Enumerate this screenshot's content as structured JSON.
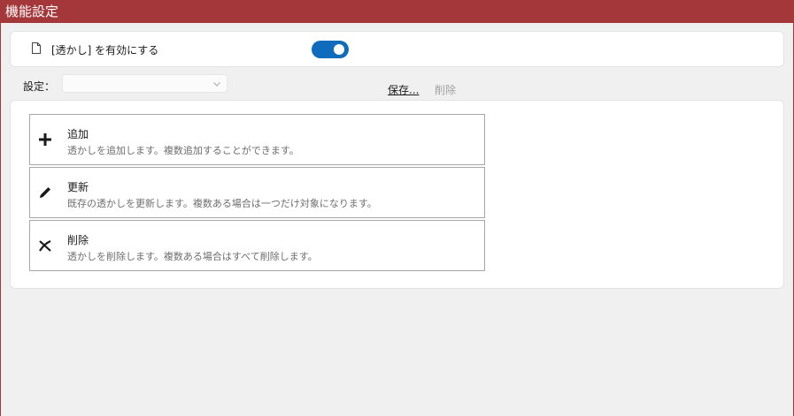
{
  "window": {
    "title": "機能設定"
  },
  "enable": {
    "label": "[透かし] を有効にする",
    "enabled": true,
    "accent": "#0f6cbd"
  },
  "settings": {
    "label": "設定：",
    "selected": "",
    "save_label": "保存...",
    "delete_label": "削除"
  },
  "actions": [
    {
      "icon": "plus-icon",
      "title": "追加",
      "desc": "透かしを追加します。複数追加することができます。"
    },
    {
      "icon": "pencil-icon",
      "title": "更新",
      "desc": "既存の透かしを更新します。複数ある場合は一つだけ対象になります。"
    },
    {
      "icon": "x-icon",
      "title": "削除",
      "desc": "透かしを削除します。複数ある場合はすべて削除します。"
    }
  ],
  "colors": {
    "titlebar": "#a4373a"
  }
}
